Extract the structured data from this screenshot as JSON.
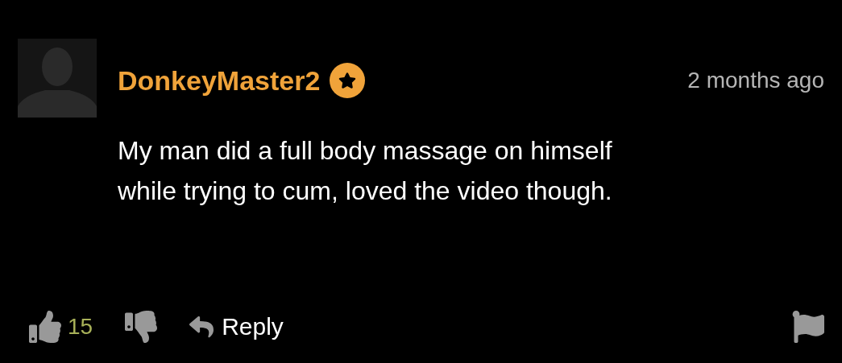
{
  "comment": {
    "username": "DonkeyMaster2",
    "verified": true,
    "time": "2 months ago",
    "text": [
      "My man did a full body massage on himself",
      "while trying to cum, loved the video though."
    ],
    "likes": "15",
    "reply": "Reply"
  }
}
